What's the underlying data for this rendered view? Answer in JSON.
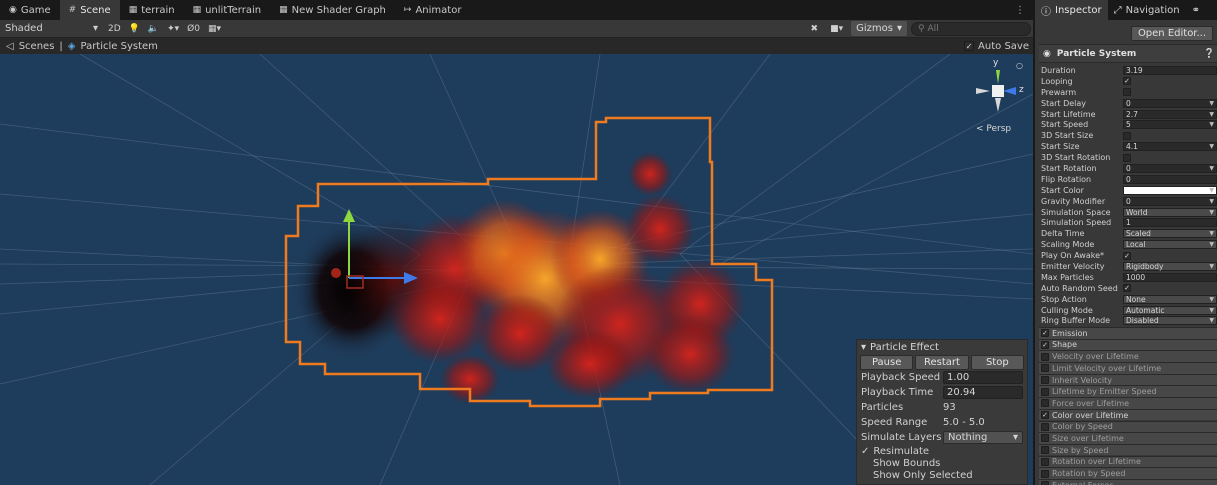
{
  "tabs": [
    {
      "label": "Game",
      "icon": "gamepad-icon"
    },
    {
      "label": "Scene",
      "icon": "grid-icon"
    },
    {
      "label": "terrain",
      "icon": "shader-icon"
    },
    {
      "label": "unlitTerrain",
      "icon": "shader-icon"
    },
    {
      "label": "New Shader Graph",
      "icon": "shader-icon"
    },
    {
      "label": "Animator",
      "icon": "animator-icon"
    }
  ],
  "toolbar": {
    "draw_mode": "Shaded",
    "mode_2d": "2D",
    "hidden_count": "0",
    "gizmos_label": "Gizmos",
    "search_placeholder": "All"
  },
  "breadcrumb": {
    "root": "Scenes",
    "current": "Particle System",
    "auto_save_label": "Auto Save"
  },
  "scene": {
    "axis_y": "y",
    "axis_z": "z",
    "persp_label": "< Persp"
  },
  "particle_effect": {
    "title": "Particle Effect",
    "buttons": {
      "pause": "Pause",
      "restart": "Restart",
      "stop": "Stop"
    },
    "rows": {
      "playback_speed": {
        "label": "Playback Speed",
        "value": "1.00"
      },
      "playback_time": {
        "label": "Playback Time",
        "value": "20.94"
      },
      "particles": {
        "label": "Particles",
        "value": "93"
      },
      "speed_range": {
        "label": "Speed Range",
        "value": "5.0 - 5.0"
      },
      "simulate_layers": {
        "label": "Simulate Layers",
        "value": "Nothing"
      }
    },
    "checks": {
      "resimulate": {
        "label": "Resimulate",
        "checked": true
      },
      "show_bounds": {
        "label": "Show Bounds",
        "checked": false
      },
      "show_only_selected": {
        "label": "Show Only Selected",
        "checked": false
      }
    }
  },
  "inspector": {
    "tabs": {
      "inspector": "Inspector",
      "navigation": "Navigation"
    },
    "open_editor": "Open Editor...",
    "component_title": "Particle System",
    "properties": [
      {
        "label": "Duration",
        "type": "field",
        "value": "3.19"
      },
      {
        "label": "Looping",
        "type": "check",
        "value": "✓"
      },
      {
        "label": "Prewarm",
        "type": "check",
        "value": ""
      },
      {
        "label": "Start Delay",
        "type": "dd",
        "value": "0"
      },
      {
        "label": "Start Lifetime",
        "type": "dd",
        "value": "2.7"
      },
      {
        "label": "Start Speed",
        "type": "dd",
        "value": "5"
      },
      {
        "label": "3D Start Size",
        "type": "check",
        "value": ""
      },
      {
        "label": "Start Size",
        "type": "dd",
        "value": "4.1"
      },
      {
        "label": "3D Start Rotation",
        "type": "check",
        "value": ""
      },
      {
        "label": "Start Rotation",
        "type": "dd",
        "value": "0"
      },
      {
        "label": "Flip Rotation",
        "type": "field",
        "value": "0"
      },
      {
        "label": "Start Color",
        "type": "color",
        "value": ""
      },
      {
        "label": "Gravity Modifier",
        "type": "dd",
        "value": "0"
      },
      {
        "label": "Simulation Space",
        "type": "select",
        "value": "World"
      },
      {
        "label": "Simulation Speed",
        "type": "field",
        "value": "1"
      },
      {
        "label": "Delta Time",
        "type": "select",
        "value": "Scaled"
      },
      {
        "label": "Scaling Mode",
        "type": "select",
        "value": "Local"
      },
      {
        "label": "Play On Awake*",
        "type": "check",
        "value": "✓"
      },
      {
        "label": "Emitter Velocity",
        "type": "select",
        "value": "Rigidbody"
      },
      {
        "label": "Max Particles",
        "type": "field",
        "value": "1000"
      },
      {
        "label": "Auto Random Seed",
        "type": "check",
        "value": "✓"
      },
      {
        "label": "Stop Action",
        "type": "select",
        "value": "None"
      },
      {
        "label": "Culling Mode",
        "type": "select",
        "value": "Automatic"
      },
      {
        "label": "Ring Buffer Mode",
        "type": "select",
        "value": "Disabled"
      }
    ],
    "modules": [
      {
        "label": "Emission",
        "checked": true
      },
      {
        "label": "Shape",
        "checked": true
      },
      {
        "label": "Velocity over Lifetime",
        "checked": false
      },
      {
        "label": "Limit Velocity over Lifetime",
        "checked": false
      },
      {
        "label": "Inherit Velocity",
        "checked": false
      },
      {
        "label": "Lifetime by Emitter Speed",
        "checked": false
      },
      {
        "label": "Force over Lifetime",
        "checked": false
      },
      {
        "label": "Color over Lifetime",
        "checked": true
      },
      {
        "label": "Color by Speed",
        "checked": false
      },
      {
        "label": "Size over Lifetime",
        "checked": false
      },
      {
        "label": "Size by Speed",
        "checked": false
      },
      {
        "label": "Rotation over Lifetime",
        "checked": false
      },
      {
        "label": "Rotation by Speed",
        "checked": false
      },
      {
        "label": "External Forces",
        "checked": false
      }
    ]
  },
  "colors": {
    "scene_bg": "#1e3c5b",
    "selection_outline": "#f07a1e",
    "axis_x": "#3f7be8",
    "axis_y": "#8ed83f",
    "axis_z": "#d83f2a"
  }
}
